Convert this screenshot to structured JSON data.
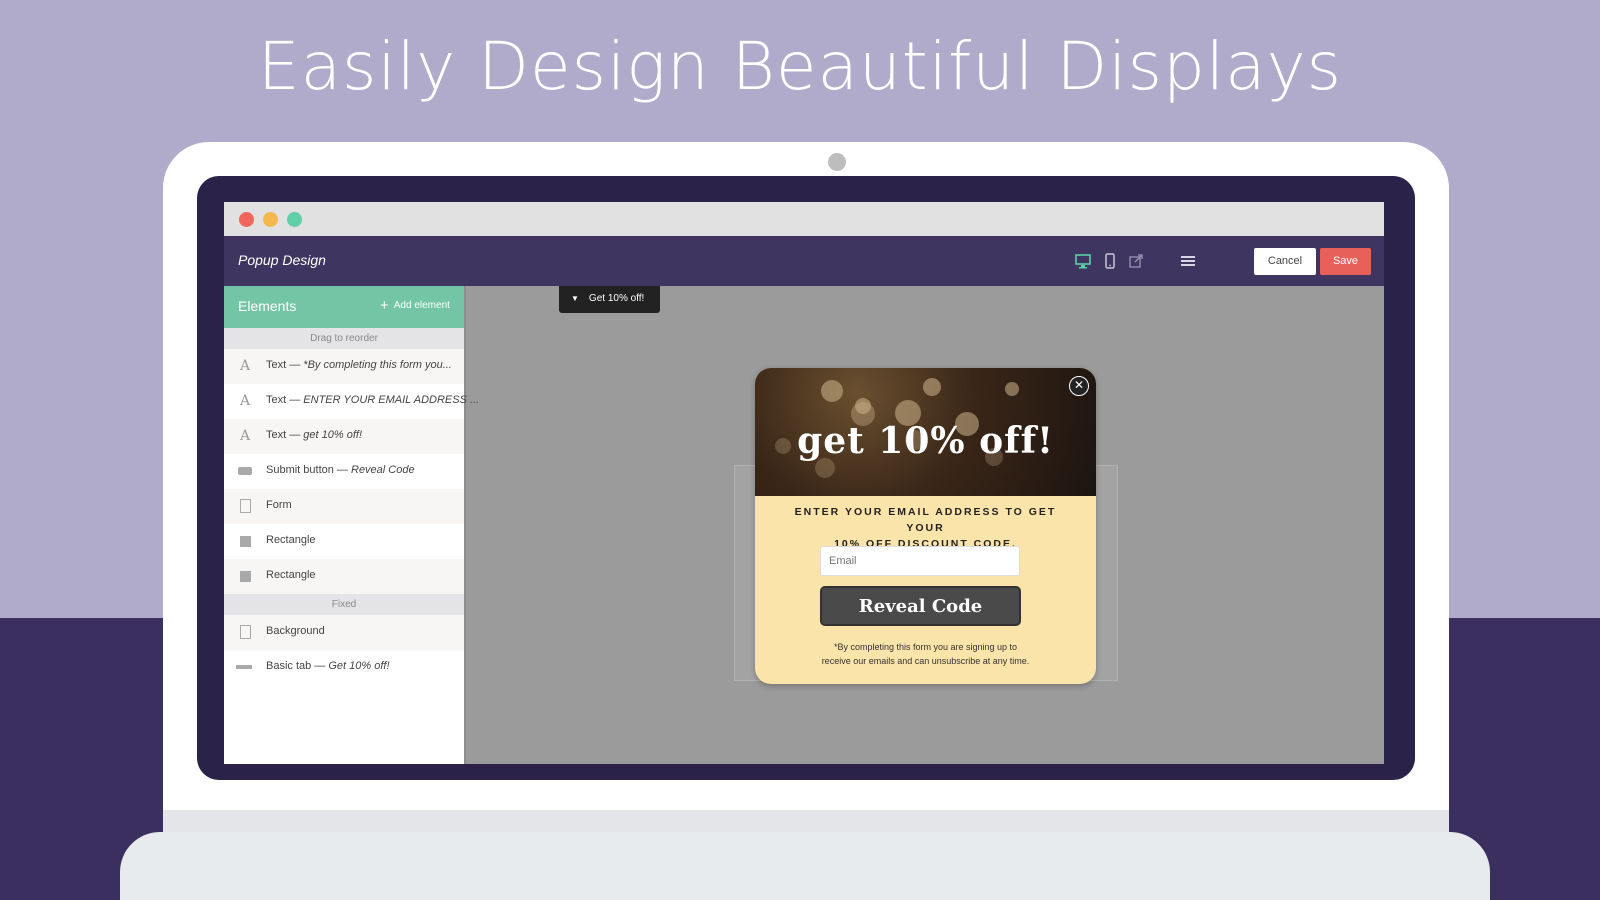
{
  "headline": "Easily Design Beautiful Displays",
  "app": {
    "title": "Popup Design",
    "cancel_label": "Cancel",
    "save_label": "Save"
  },
  "sidebar": {
    "title": "Elements",
    "add_label": "Add element",
    "drag_label": "Drag to reorder",
    "fixed_label": "Fixed",
    "items": [
      {
        "icon": "text-icon",
        "label": "Text — ",
        "detail": "*By completing this form you..."
      },
      {
        "icon": "text-icon",
        "label": "Text — ",
        "detail": "ENTER YOUR EMAIL ADDRESS ..."
      },
      {
        "icon": "text-icon",
        "label": "Text — ",
        "detail": "get 10% off!"
      },
      {
        "icon": "button-icon",
        "label": "Submit button — ",
        "detail": "Reveal Code"
      },
      {
        "icon": "form-icon",
        "label": "Form",
        "detail": ""
      },
      {
        "icon": "rectangle-icon",
        "label": "Rectangle",
        "detail": ""
      },
      {
        "icon": "rectangle-icon",
        "label": "Rectangle",
        "detail": ""
      }
    ],
    "fixed_items": [
      {
        "icon": "page-icon",
        "label": "Background",
        "detail": ""
      },
      {
        "icon": "tab-icon",
        "label": "Basic tab — ",
        "detail": "Get 10% off!"
      }
    ]
  },
  "canvas": {
    "tab_label": "Get 10% off!"
  },
  "popup": {
    "headline": "get 10% off!",
    "cta_line1": "ENTER YOUR EMAIL ADDRESS TO GET YOUR",
    "cta_line2": "10% OFF DISCOUNT CODE.",
    "email_placeholder": "Email",
    "button_label": "Reveal Code",
    "fine_line1": "*By completing this form you are signing up to",
    "fine_line2": "receive our emails and can unsubscribe at any time."
  },
  "colors": {
    "background_top": "#b1abcb",
    "background_bottom": "#3b2f5f",
    "appbar": "#3e3660",
    "sidebar_header": "#73c5a5",
    "save_button": "#e7605a",
    "popup_body": "#fbe4a9"
  }
}
